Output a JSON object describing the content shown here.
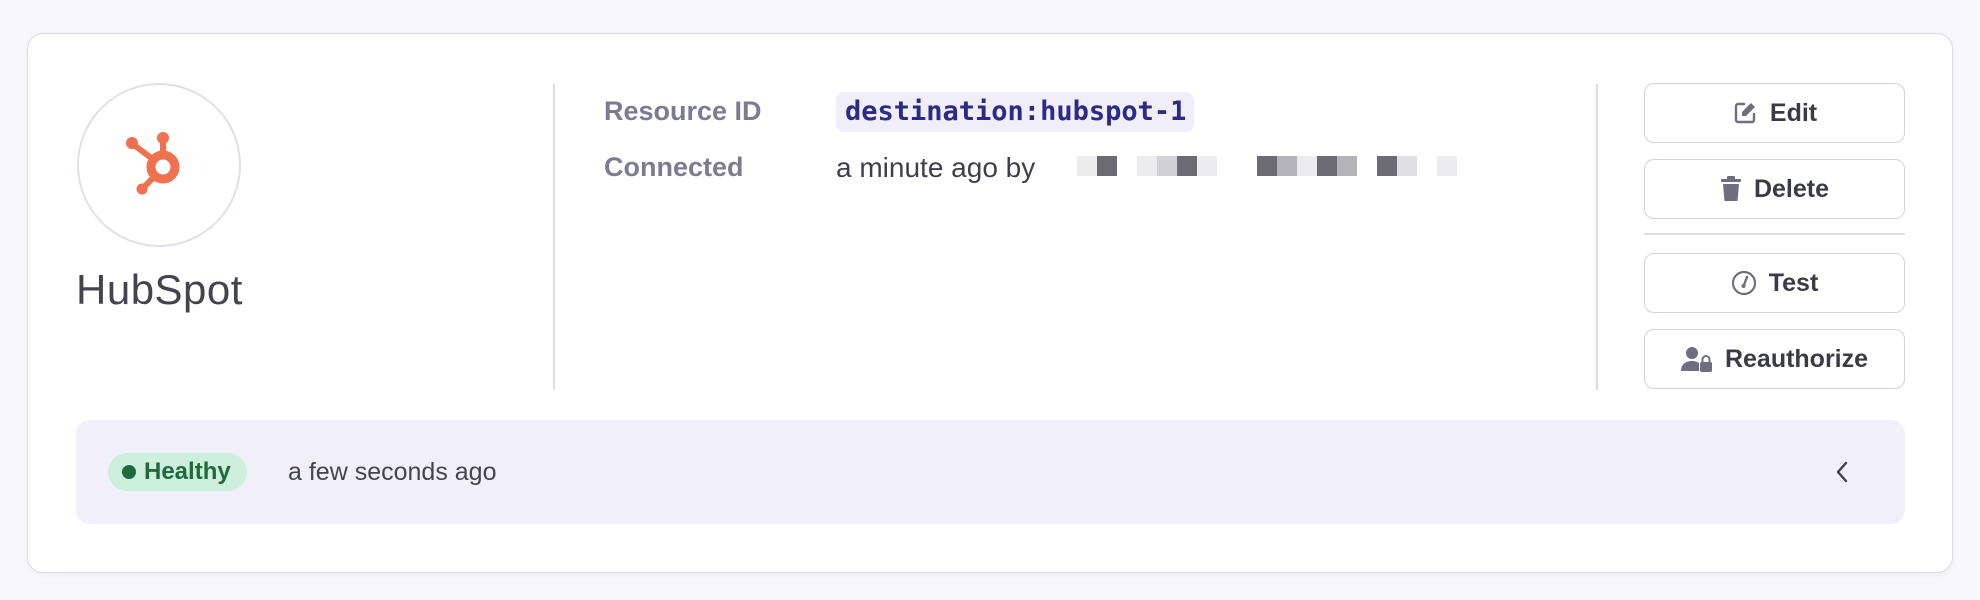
{
  "destination": {
    "name": "HubSpot",
    "logo_icon": "hubspot-logo",
    "brand_color": "#f0714f"
  },
  "metadata": {
    "resource_label": "Resource ID",
    "resource_id": "destination:hubspot-1",
    "connected_label": "Connected",
    "connected_value": "a minute ago by"
  },
  "actions": {
    "edit": {
      "label": "Edit",
      "icon": "edit-icon"
    },
    "delete": {
      "label": "Delete",
      "icon": "trash-icon"
    },
    "test": {
      "label": "Test",
      "icon": "gauge-icon"
    },
    "reauthorize": {
      "label": "Reauthorize",
      "icon": "user-lock-icon"
    }
  },
  "status": {
    "badge": "Healthy",
    "badge_color": "#1f6a3c",
    "badge_bg": "#cdefdb",
    "time": "a few seconds ago",
    "expand_icon": "chevron-left-icon"
  }
}
